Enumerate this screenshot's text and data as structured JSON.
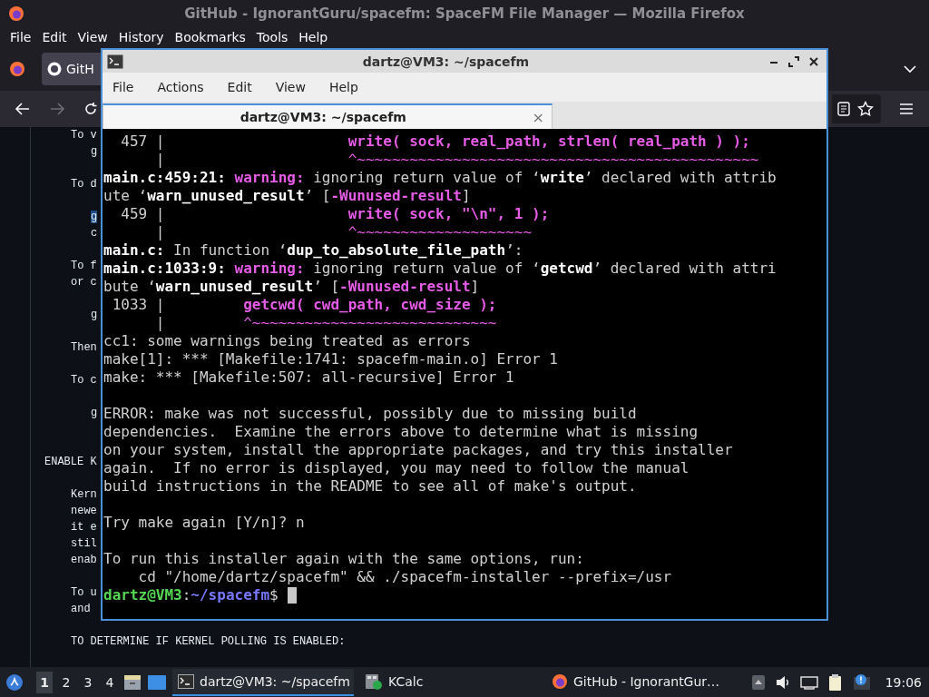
{
  "browser": {
    "title": "GitHub - IgnorantGuru/spacefm: SpaceFM File Manager — Mozilla Firefox",
    "menu": [
      "File",
      "Edit",
      "View",
      "History",
      "Bookmarks",
      "Tools",
      "Help"
    ],
    "tab": {
      "label": "GitH"
    },
    "readme": [
      {
        "kind": "text",
        "text": "To v"
      },
      {
        "kind": "code",
        "text": "g",
        "highlighted": false
      },
      {
        "kind": "gap"
      },
      {
        "kind": "text",
        "text": "To d"
      },
      {
        "kind": "gap"
      },
      {
        "kind": "code",
        "text": "g",
        "highlighted": true
      },
      {
        "kind": "code",
        "text": "c",
        "highlighted": false
      },
      {
        "kind": "gap"
      },
      {
        "kind": "text",
        "text": "To f"
      },
      {
        "kind": "text",
        "text": "or c"
      },
      {
        "kind": "gap"
      },
      {
        "kind": "code",
        "text": "g",
        "highlighted": false
      },
      {
        "kind": "gap"
      },
      {
        "kind": "text",
        "text": "Then"
      },
      {
        "kind": "gap"
      },
      {
        "kind": "text",
        "text": "To c"
      },
      {
        "kind": "gap"
      },
      {
        "kind": "code",
        "text": "g",
        "highlighted": false
      },
      {
        "kind": "gap"
      },
      {
        "kind": "gap"
      },
      {
        "kind": "heading",
        "text": "ENABLE K"
      },
      {
        "kind": "gap"
      },
      {
        "kind": "text",
        "text": "Kern"
      },
      {
        "kind": "text",
        "text": "newe"
      },
      {
        "kind": "text",
        "text": "it e"
      },
      {
        "kind": "text",
        "text": "stil"
      },
      {
        "kind": "text",
        "text": "enab"
      },
      {
        "kind": "gap"
      },
      {
        "kind": "text",
        "text": "To u"
      },
      {
        "kind": "text",
        "text": "and"
      },
      {
        "kind": "gap"
      },
      {
        "kind": "text",
        "text": "TO DETERMINE IF KERNEL POLLING IS ENABLED:"
      }
    ]
  },
  "terminal": {
    "title": "dartz@VM3: ~/spacefm",
    "menu": [
      "File",
      "Actions",
      "Edit",
      "View",
      "Help"
    ],
    "tab": {
      "label": "dartz@VM3: ~/spacefm",
      "selected": true,
      "close": "×"
    },
    "blocks": [
      {
        "lines": [
          {
            "segments": [
              {
                "text": "  457 |                     ",
                "kind": "plain"
              },
              {
                "text": "write( sock, real_path, strlen( real_path ) );",
                "kind": "magenta-bold"
              }
            ]
          },
          {
            "segments": [
              {
                "text": "      |                     ",
                "kind": "plain"
              },
              {
                "text": "^~~~~~~~~~~~~~~~~~~~~~~~~~~~~~~~~~~~~~~~~~~~~~~",
                "kind": "magenta"
              }
            ]
          },
          {
            "segments": [
              {
                "text": "main.c:459:21: ",
                "kind": "bold"
              },
              {
                "text": "warning:",
                "kind": "magenta-bold"
              },
              {
                "text": " ignoring return value of ‘",
                "kind": "plain"
              },
              {
                "text": "write",
                "kind": "bold"
              },
              {
                "text": "’ declared with attrib",
                "kind": "plain"
              }
            ]
          },
          {
            "segments": [
              {
                "text": "ute ‘",
                "kind": "plain"
              },
              {
                "text": "warn_unused_result",
                "kind": "bold"
              },
              {
                "text": "’ [",
                "kind": "plain"
              },
              {
                "text": "-Wunused-result",
                "kind": "magenta-bold"
              },
              {
                "text": "]",
                "kind": "plain"
              }
            ]
          },
          {
            "segments": [
              {
                "text": "  459 |                     ",
                "kind": "plain"
              },
              {
                "text": "write( sock, \"\\n\", 1 );",
                "kind": "magenta-bold"
              }
            ]
          },
          {
            "segments": [
              {
                "text": "      |                     ",
                "kind": "plain"
              },
              {
                "text": "^~~~~~~~~~~~~~~~~~~~~",
                "kind": "magenta"
              }
            ]
          },
          {
            "segments": [
              {
                "text": "main.c:",
                "kind": "bold"
              },
              {
                "text": " In function ‘",
                "kind": "plain"
              },
              {
                "text": "dup_to_absolute_file_path",
                "kind": "bold"
              },
              {
                "text": "’:",
                "kind": "plain"
              }
            ]
          },
          {
            "segments": [
              {
                "text": "main.c:1033:9: ",
                "kind": "bold"
              },
              {
                "text": "warning:",
                "kind": "magenta-bold"
              },
              {
                "text": " ignoring return value of ‘",
                "kind": "plain"
              },
              {
                "text": "getcwd",
                "kind": "bold"
              },
              {
                "text": "’ declared with attri",
                "kind": "plain"
              }
            ]
          },
          {
            "segments": [
              {
                "text": "bute ‘",
                "kind": "plain"
              },
              {
                "text": "warn_unused_result",
                "kind": "bold"
              },
              {
                "text": "’ [",
                "kind": "plain"
              },
              {
                "text": "-Wunused-result",
                "kind": "magenta-bold"
              },
              {
                "text": "]",
                "kind": "plain"
              }
            ]
          },
          {
            "segments": [
              {
                "text": " 1033 |         ",
                "kind": "plain"
              },
              {
                "text": "getcwd( cwd_path, cwd_size );",
                "kind": "magenta-bold"
              }
            ]
          },
          {
            "segments": [
              {
                "text": "      |         ",
                "kind": "plain"
              },
              {
                "text": "^~~~~~~~~~~~~~~~~~~~~~~~~~~~~",
                "kind": "magenta"
              }
            ]
          },
          {
            "segments": [
              {
                "text": "cc1: some warnings being treated as errors",
                "kind": "plain"
              }
            ]
          },
          {
            "segments": [
              {
                "text": "make[1]: *** [Makefile:1741: spacefm-main.o] Error 1",
                "kind": "plain"
              }
            ]
          },
          {
            "segments": [
              {
                "text": "make: *** [Makefile:507: all-recursive] Error 1",
                "kind": "plain"
              }
            ]
          }
        ]
      },
      {
        "lines": [
          {
            "segments": [
              {
                "text": "ERROR: make was not successful, possibly due to missing build",
                "kind": "plain"
              }
            ]
          },
          {
            "segments": [
              {
                "text": "dependencies.  Examine the errors above to determine what is missing",
                "kind": "plain"
              }
            ]
          },
          {
            "segments": [
              {
                "text": "on your system, install the appropriate packages, and try this installer",
                "kind": "plain"
              }
            ]
          },
          {
            "segments": [
              {
                "text": "again.  If no error is displayed, you may need to follow the manual",
                "kind": "plain"
              }
            ]
          },
          {
            "segments": [
              {
                "text": "build instructions in the README to see all of make's output.",
                "kind": "plain"
              }
            ]
          }
        ]
      },
      {
        "lines": [
          {
            "segments": [
              {
                "text": "Try make again [Y/n]? n",
                "kind": "plain"
              }
            ]
          }
        ]
      },
      {
        "lines": [
          {
            "segments": [
              {
                "text": "To run this installer again with the same options, run:",
                "kind": "plain"
              }
            ]
          },
          {
            "segments": [
              {
                "text": "    cd \"/home/dartz/spacefm\" && ./spacefm-installer --prefix=/usr",
                "kind": "plain"
              }
            ]
          },
          {
            "segments": [
              {
                "text": "dartz@VM3",
                "kind": "green-bold"
              },
              {
                "text": ":",
                "kind": "plain"
              },
              {
                "text": "~/spacefm",
                "kind": "blue-bold"
              },
              {
                "text": "$",
                "kind": "plain"
              }
            ],
            "cursor": true
          }
        ]
      }
    ]
  },
  "taskbar": {
    "workspaces": [
      {
        "label": "1",
        "selected": true
      },
      {
        "label": "2",
        "selected": false
      },
      {
        "label": "3",
        "selected": false
      },
      {
        "label": "4",
        "selected": false
      }
    ],
    "tasks": [
      {
        "label": "dartz@VM3: ~/spacefm",
        "kind": "terminal",
        "selected": true
      },
      {
        "label": "KCalc",
        "kind": "calculator",
        "selected": false
      },
      {
        "label": "GitHub - IgnorantGur…",
        "kind": "browser",
        "selected": false
      }
    ],
    "clock": "19:06"
  }
}
